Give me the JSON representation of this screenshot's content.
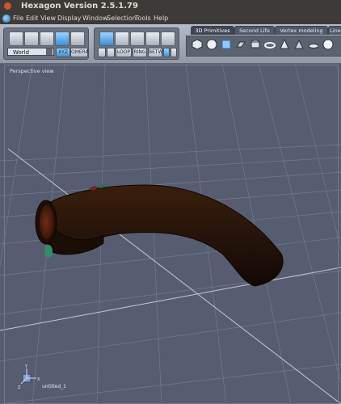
{
  "window": {
    "title": "Hexagon Version 2.5.1.79"
  },
  "menu": [
    "File",
    "Edit",
    "View",
    "Display",
    "Window",
    "Selection",
    "Tools",
    "Help"
  ],
  "toolbar": {
    "space_select": "World",
    "xyz_label": "XYZ",
    "camera_label": "OMERA",
    "selection_buttons": [
      "LOOP",
      "RING",
      "BETW"
    ],
    "tabs": [
      "3D Primitives",
      "Second Life",
      "Vertex modeling",
      "Line"
    ]
  },
  "viewport": {
    "label": "Perspective view",
    "document_name": "untitled_1",
    "axis_labels": {
      "y": "Y",
      "x": "X",
      "z": "Z"
    }
  },
  "colors": {
    "viewport_bg": "#575d70",
    "object": "#2a1508",
    "accent_blue": "#3a8fd8"
  }
}
